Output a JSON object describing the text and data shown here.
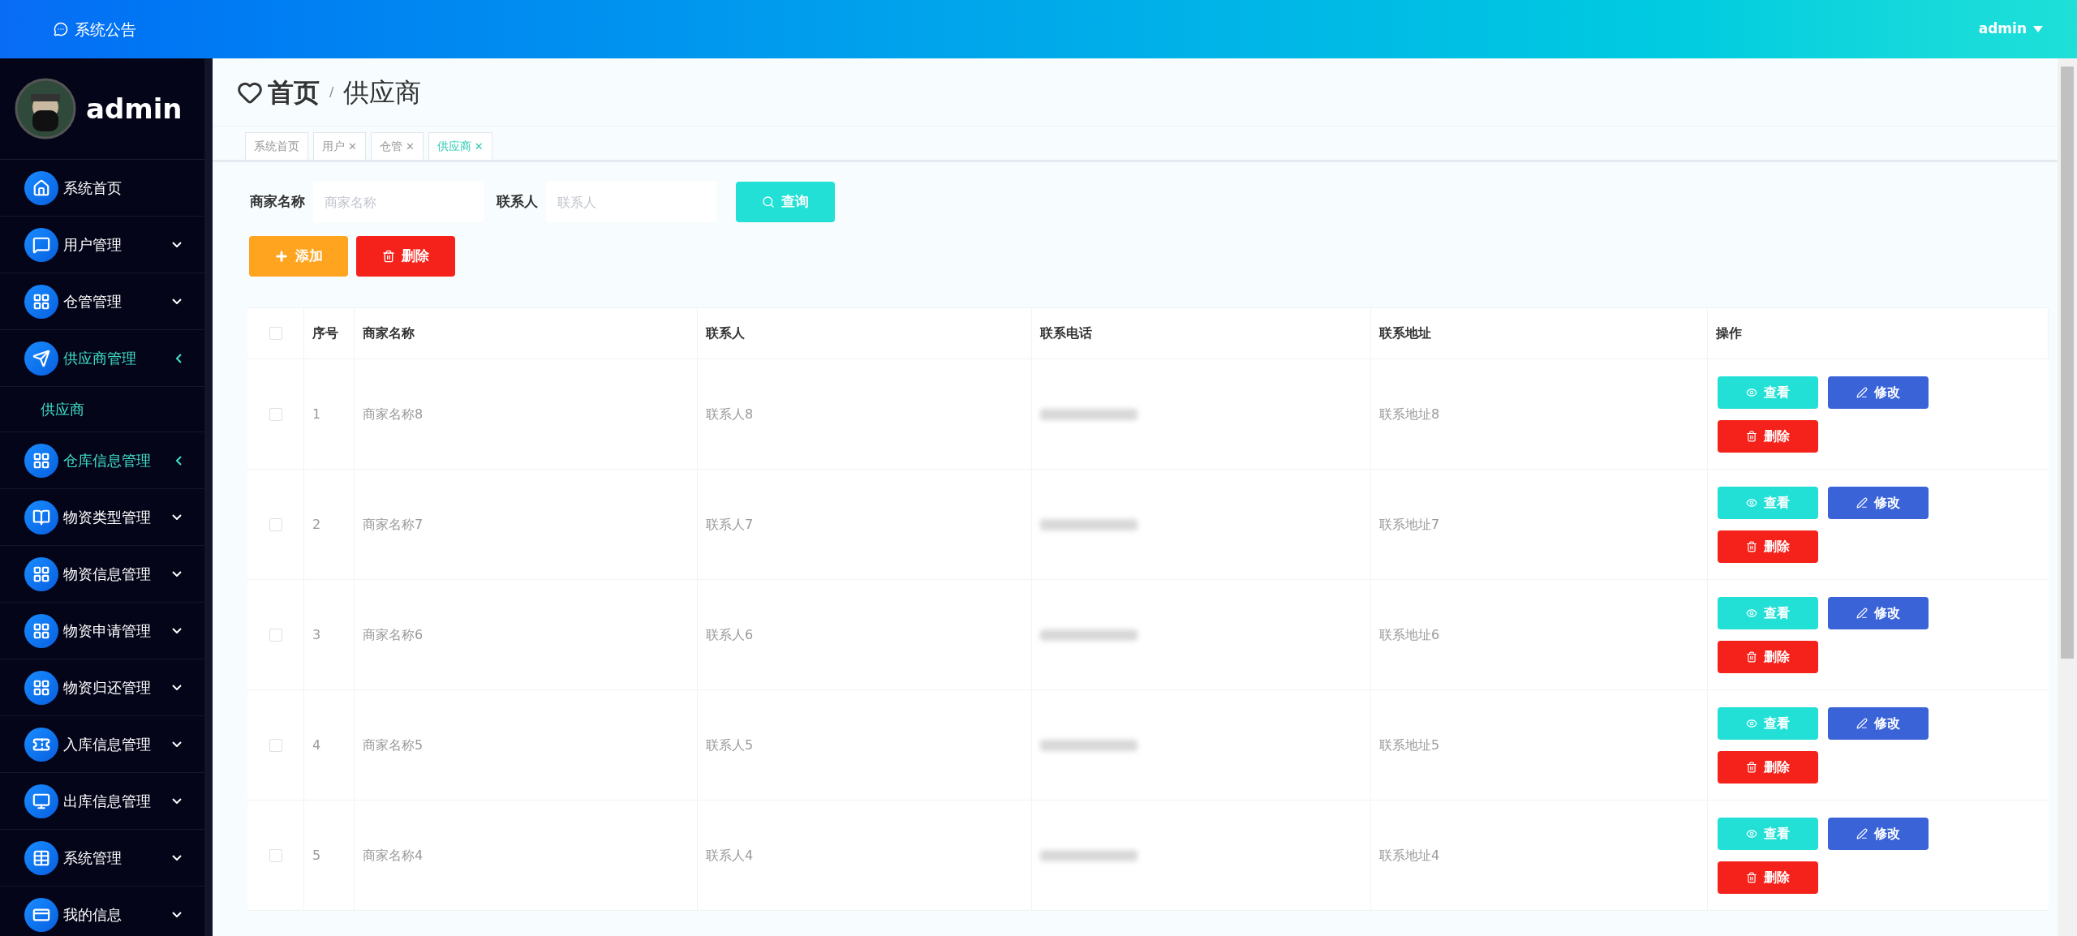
{
  "topbar": {
    "notice": "系统公告",
    "user": "admin"
  },
  "sidebar": {
    "username": "admin",
    "items": [
      {
        "label": "系统首页",
        "kind": "link",
        "highlighted": false
      },
      {
        "label": "用户管理",
        "kind": "menu",
        "highlighted": false,
        "expanded": false
      },
      {
        "label": "仓管管理",
        "kind": "menu",
        "highlighted": false,
        "expanded": false
      },
      {
        "label": "供应商管理",
        "kind": "menu",
        "highlighted": true,
        "expanded": true,
        "children": [
          {
            "label": "供应商",
            "selected": true
          }
        ]
      },
      {
        "label": "仓库信息管理",
        "kind": "menu",
        "highlighted": true,
        "expanded": true
      },
      {
        "label": "物资类型管理",
        "kind": "menu",
        "highlighted": false,
        "expanded": false
      },
      {
        "label": "物资信息管理",
        "kind": "menu",
        "highlighted": false,
        "expanded": false
      },
      {
        "label": "物资申请管理",
        "kind": "menu",
        "highlighted": false,
        "expanded": false
      },
      {
        "label": "物资归还管理",
        "kind": "menu",
        "highlighted": false,
        "expanded": false
      },
      {
        "label": "入库信息管理",
        "kind": "menu",
        "highlighted": false,
        "expanded": false
      },
      {
        "label": "出库信息管理",
        "kind": "menu",
        "highlighted": false,
        "expanded": false
      },
      {
        "label": "系统管理",
        "kind": "menu",
        "highlighted": false,
        "expanded": false
      },
      {
        "label": "我的信息",
        "kind": "menu",
        "highlighted": false,
        "expanded": false
      }
    ]
  },
  "breadcrumb": {
    "home": "首页",
    "separator": "/",
    "current": "供应商"
  },
  "tabs": [
    {
      "label": "系统首页",
      "selected": false
    },
    {
      "label": "用户",
      "close": "✕",
      "selected": false
    },
    {
      "label": "仓管",
      "close": "✕",
      "selected": false
    },
    {
      "label": "供应商",
      "close": "✕",
      "selected": true
    }
  ],
  "search": {
    "fields": [
      {
        "label": "商家名称",
        "placeholder": "商家名称"
      },
      {
        "label": "联系人",
        "placeholder": "联系人"
      }
    ],
    "button": "查询"
  },
  "actions": {
    "add": "添加",
    "delete": "删除"
  },
  "table": {
    "select_all_checked": false,
    "columns": [
      "序号",
      "商家名称",
      "联系人",
      "联系电话",
      "联系地址",
      "操作"
    ],
    "rows": [
      {
        "index": "1",
        "name": "商家名称8",
        "contact": "联系人8",
        "address": "联系地址8",
        "checked": false,
        "buttons": [
          "查看",
          "修改",
          "删除"
        ]
      },
      {
        "index": "2",
        "name": "商家名称7",
        "contact": "联系人7",
        "address": "联系地址7",
        "checked": false,
        "buttons": [
          "查看",
          "修改",
          "删除"
        ]
      },
      {
        "index": "3",
        "name": "商家名称6",
        "contact": "联系人6",
        "address": "联系地址6",
        "checked": false,
        "buttons": [
          "查看",
          "修改",
          "删除"
        ]
      },
      {
        "index": "4",
        "name": "商家名称5",
        "contact": "联系人5",
        "address": "联系地址5",
        "checked": false,
        "buttons": [
          "查看",
          "修改",
          "删除"
        ]
      },
      {
        "index": "5",
        "name": "商家名称4",
        "contact": "联系人4",
        "address": "联系地址4",
        "checked": false,
        "buttons": [
          "查看",
          "修改",
          "删除"
        ]
      }
    ]
  }
}
